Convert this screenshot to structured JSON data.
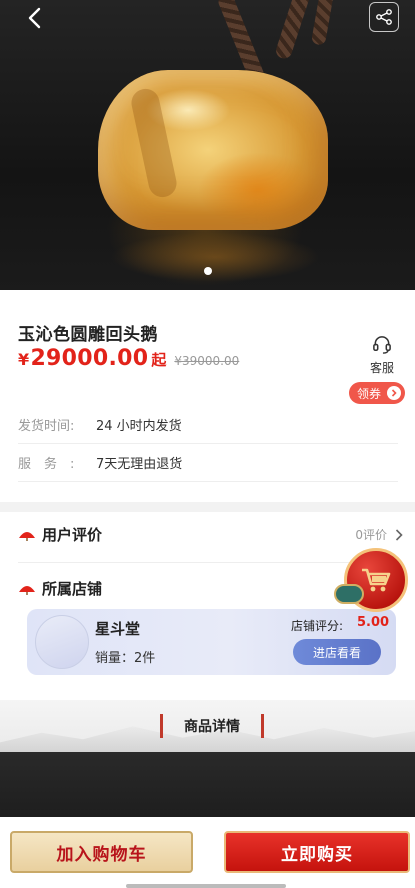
{
  "product": {
    "title": "玉沁色圆雕回头鹅",
    "price_currency": "¥",
    "price": "29000.00",
    "price_suffix": "起",
    "original_price": "¥39000.00"
  },
  "actions_top": {
    "service_label": "客服",
    "coupon_label": "领券"
  },
  "meta": {
    "shipping_label": "发货时间:",
    "shipping_value": "24 小时内发货",
    "service_label": "服　务　:",
    "service_value": "7天无理由退货"
  },
  "reviews": {
    "heading": "用户评价",
    "count_text": "0评价"
  },
  "shop": {
    "heading": "所属店铺",
    "name": "星斗堂",
    "sales": "销量：2件",
    "score_label": "店铺评分:",
    "score": "5.00",
    "visit_label": "进店看看"
  },
  "details": {
    "heading": "商品详情"
  },
  "bottom_bar": {
    "add_to_cart": "加入购物车",
    "buy_now": "立即购买"
  },
  "colors": {
    "accent_red": "#e2231a",
    "coupon": "#f0574a",
    "visit_button": "#5a72c7"
  },
  "carousel": {
    "page": 1,
    "total": 1
  }
}
